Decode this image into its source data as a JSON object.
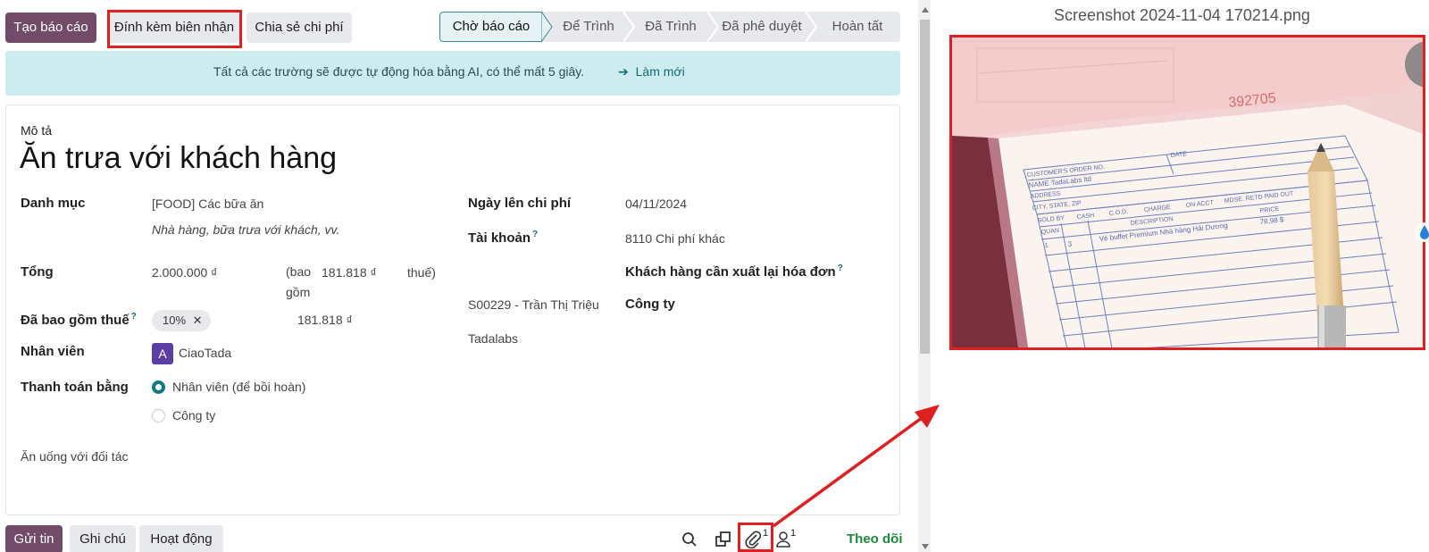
{
  "toolbar": {
    "create_report": "Tạo báo cáo",
    "attach_receipt": "Đính kèm biên nhận",
    "split_expense": "Chia sẻ chi phí"
  },
  "stages": [
    "Chờ báo cáo",
    "Để Trình",
    "Đã Trình",
    "Đã phê duyệt",
    "Hoàn tất"
  ],
  "banner": {
    "text": "Tất cả các trường sẽ được tự động hóa bằng AI, có thể mất 5 giây.",
    "link": "Làm mới"
  },
  "form": {
    "description_label": "Mô tả",
    "title": "Ăn trưa với khách hàng",
    "category_label": "Danh mục",
    "category_value": "[FOOD] Các bữa ăn",
    "category_hint": "Nhà hàng, bữa trưa với khách, vv.",
    "total_label": "Tổng",
    "total_value": "2.000.000 ₫",
    "tax_prefix": "(bao gồm",
    "tax_amount": "181.818 ₫",
    "tax_suffix": "thuế)",
    "tax_included_label": "Đã bao gồm thuế",
    "tax_tag": "10%",
    "tax_included_amount": "181.818 ₫",
    "employee_label": "Nhân viên",
    "employee_initial": "A",
    "employee_name": "CiaoTada",
    "paid_by_label": "Thanh toán bằng",
    "paid_by_employee": "Nhân viên (để bồi hoàn)",
    "paid_by_company": "Công ty",
    "expense_date_label": "Ngày lên chi phí",
    "expense_date": "04/11/2024",
    "account_label": "Tài khoản",
    "account_value": "8110 Chi phí khác",
    "reinvoice_label": "Khách hàng cần xuất lại hóa đơn",
    "reinvoice_value": "S00229 - Trần Thị Triệu",
    "company_label": "Công ty",
    "company_value": "Tadalabs",
    "note": "Ăn uống với đối tác",
    "help_mark": "?"
  },
  "chatter": {
    "send_message": "Gửi tin",
    "log_note": "Ghi chú",
    "activity": "Hoạt động",
    "attachment_count": "1",
    "follower_count": "1",
    "follow": "Theo dõi"
  },
  "preview": {
    "filename": "Screenshot 2024-11-04 170214.png",
    "receipt_number": "392705",
    "receipt_name": "NAME TadaLabs ltd",
    "receipt_item": "Vé buffet Premium Nhà hàng Hải Dương",
    "receipt_qty": "3",
    "receipt_price": "78,98 $",
    "h_customer_order": "CUSTOMER'S ORDER NO.",
    "h_date": "DATE",
    "h_address": "ADDRESS",
    "h_city": "CITY, STATE, ZIP",
    "h_sold_by": "SOLD BY",
    "h_cash": "CASH",
    "h_cod": "C.O.D.",
    "h_charge": "CHARGE",
    "h_on_acct": "ON ACCT",
    "h_mdse": "MDSE. RETD",
    "h_paid_out": "PAID OUT",
    "h_quan": "QUAN",
    "h_description": "DESCRIPTION",
    "h_price": "PRICE"
  },
  "colors": {
    "primary": "#714b67",
    "accent": "#0f7a83",
    "highlight": "#e02020",
    "banner": "#cdecef"
  }
}
